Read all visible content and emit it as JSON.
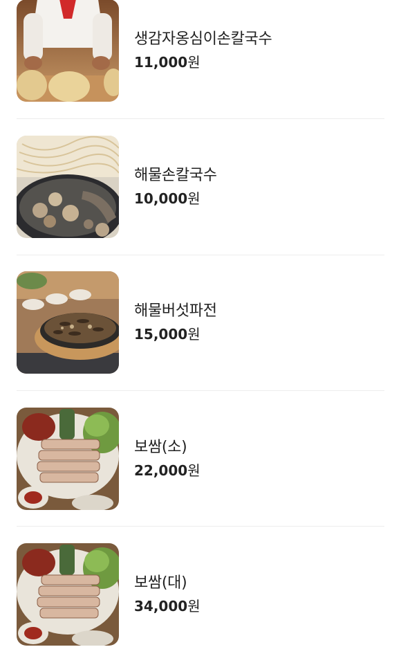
{
  "menu": {
    "items": [
      {
        "name": "생감자옹심이손칼국수",
        "price": "11,000",
        "unit": "원",
        "image": "chef-kneading-dough-photo"
      },
      {
        "name": "해물손칼국수",
        "price": "10,000",
        "unit": "원",
        "image": "seafood-kalguksu-photo"
      },
      {
        "name": "해물버섯파전",
        "price": "15,000",
        "unit": "원",
        "image": "seafood-mushroom-pancake-photo"
      },
      {
        "name": "보쌈(소)",
        "price": "22,000",
        "unit": "원",
        "image": "bossam-small-photo"
      },
      {
        "name": "보쌈(대)",
        "price": "34,000",
        "unit": "원",
        "image": "bossam-large-photo"
      }
    ]
  },
  "colors": {
    "text": "#222222",
    "divider": "#ededed",
    "background": "#ffffff"
  }
}
